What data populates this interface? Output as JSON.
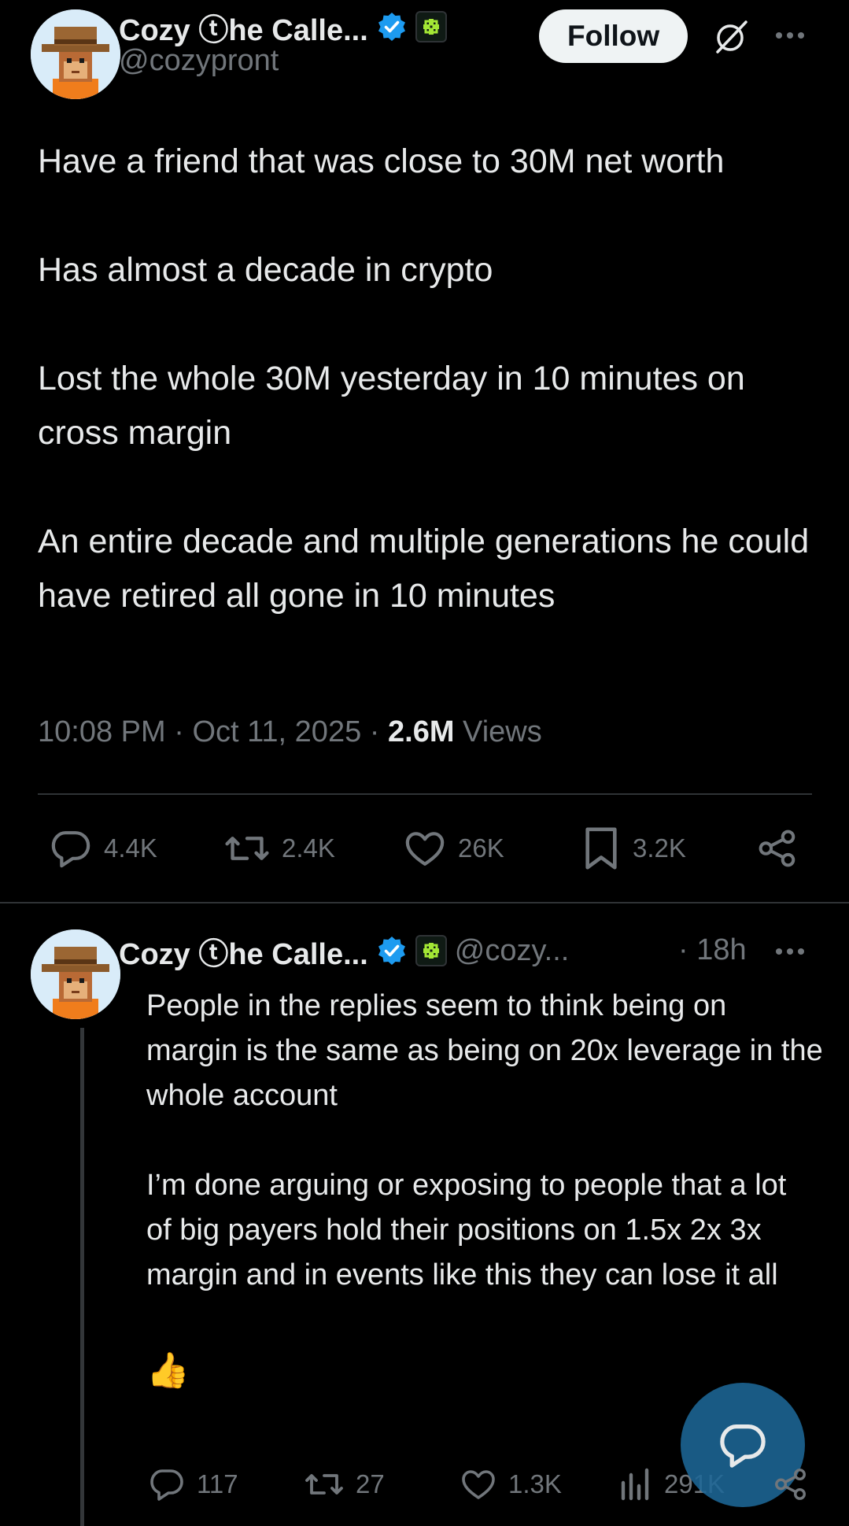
{
  "tweet": {
    "author_name": "Cozy ⓣhe Calle...",
    "author_handle": "@cozypront",
    "follow_label": "Follow",
    "paragraphs": [
      "Have a friend that was close to 30M net worth",
      "Has almost a decade in crypto",
      "Lost the whole 30M yesterday in 10 minutes on cross margin",
      "An entire decade and multiple generations he could have retired all gone in 10 minutes"
    ],
    "time": "10:08 PM",
    "date": "Oct 11, 2025",
    "views_count": "2.6M",
    "views_label": "Views",
    "separator": "·",
    "replies": "4.4K",
    "reposts": "2.4K",
    "likes": "26K",
    "bookmarks": "3.2K"
  },
  "reply": {
    "author_name": "Cozy ⓣhe Calle...",
    "author_handle": "@cozy...",
    "age": "· 18h",
    "paragraphs": [
      "People in the replies seem to think being on margin is the same as being on 20x leverage in the whole account",
      "I’m done arguing or exposing to people that a lot of big payers hold their positions on 1.5x 2x 3x margin and in events like this they can lose it all",
      "👍"
    ],
    "replies": "117",
    "reposts": "27",
    "likes": "1.3K",
    "views": "291K"
  },
  "icons": {
    "verified": "verified-badge-icon",
    "affiliate": "affiliate-badge-icon",
    "grok": "grok-icon",
    "more": "more-options-icon",
    "reply": "reply-icon",
    "repost": "repost-icon",
    "like": "like-icon",
    "bookmark": "bookmark-icon",
    "share": "share-icon",
    "views": "views-icon",
    "compose": "compose-reply-icon"
  },
  "colors": {
    "background": "#000000",
    "text": "#e7e9ea",
    "secondary": "#71767b",
    "verified_blue": "#1d9bf0",
    "affiliate_green": "#a3e635",
    "fab": "#1d6796"
  }
}
